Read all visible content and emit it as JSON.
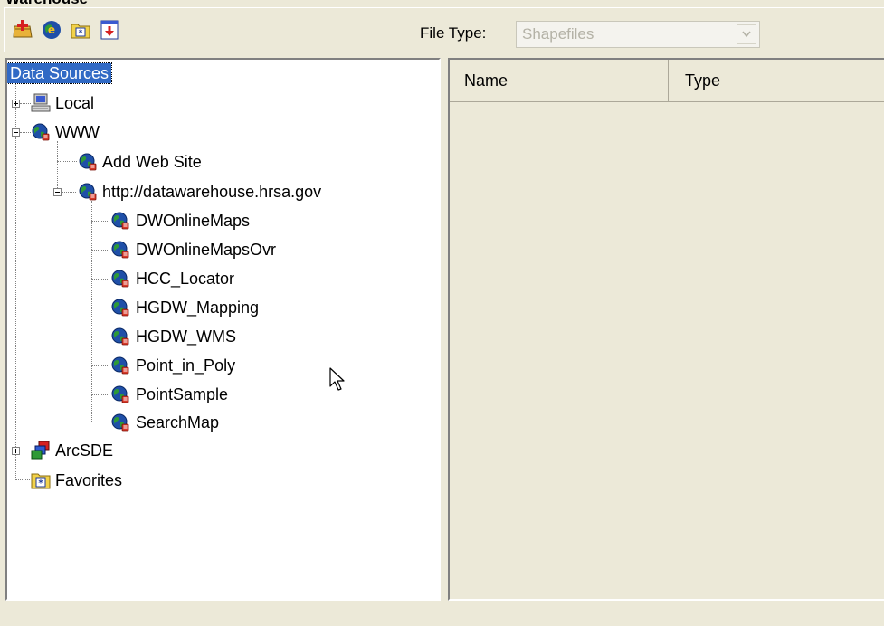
{
  "window": {
    "title": "Warehouse"
  },
  "toolbar": {
    "buttons": [
      {
        "name": "add-data-source",
        "icon": "add-source-icon"
      },
      {
        "name": "connect-internet",
        "icon": "globe-e-icon"
      },
      {
        "name": "add-favorite",
        "icon": "favorite-folder-icon"
      },
      {
        "name": "download",
        "icon": "download-icon"
      }
    ],
    "file_type_label": "File Type:",
    "file_type_value": "Shapefiles"
  },
  "tree": {
    "root_label": "Data Sources",
    "local": "Local",
    "www": "WWW",
    "add_web_site": "Add Web Site",
    "site": "http://datawarehouse.hrsa.gov",
    "services": [
      "DWOnlineMaps",
      "DWOnlineMapsOvr",
      "HCC_Locator",
      "HGDW_Mapping",
      "HGDW_WMS",
      "Point_in_Poly",
      "PointSample",
      "SearchMap"
    ],
    "arcsde": "ArcSDE",
    "favorites": "Favorites"
  },
  "list": {
    "columns": [
      "Name",
      "Type"
    ]
  },
  "colors": {
    "window_bg": "#ece9d8",
    "selection": "#316ac5",
    "globe_blue": "#1f4fa8",
    "globe_green": "#2e9a36"
  }
}
